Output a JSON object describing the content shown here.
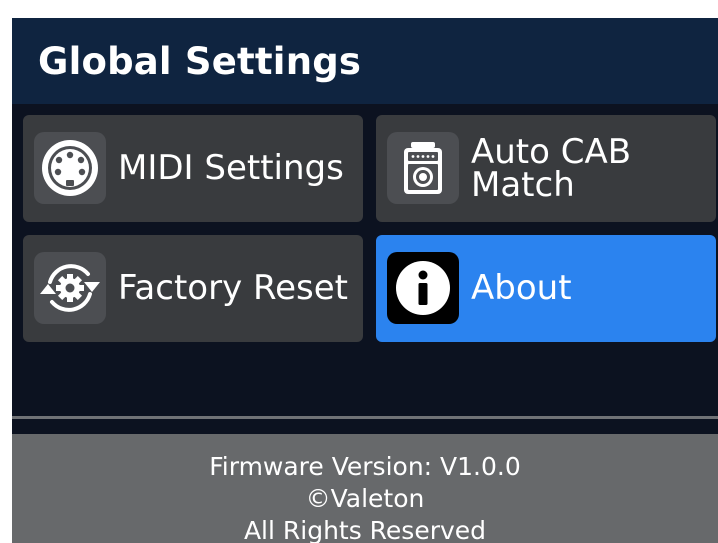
{
  "header": {
    "title": "Global Settings"
  },
  "menu": {
    "items": [
      {
        "id": "midi-settings",
        "label": "MIDI Settings",
        "icon": "midi-connector-icon",
        "selected": false
      },
      {
        "id": "auto-cab-match",
        "label": "Auto CAB\nMatch",
        "icon": "cabinet-speaker-icon",
        "selected": false
      },
      {
        "id": "factory-reset",
        "label": "Factory Reset",
        "icon": "reset-gear-icon",
        "selected": false
      },
      {
        "id": "about",
        "label": "About",
        "icon": "info-icon",
        "selected": true
      }
    ]
  },
  "footer": {
    "firmware": "Firmware Version: V1.0.0",
    "copyright": "©Valeton",
    "rights": "All Rights Reserved"
  },
  "colors": {
    "background": "#0c1220",
    "header": "#0f2440",
    "tile": "#393b3e",
    "tile_selected": "#2b83ef",
    "footer": "#67696b"
  }
}
